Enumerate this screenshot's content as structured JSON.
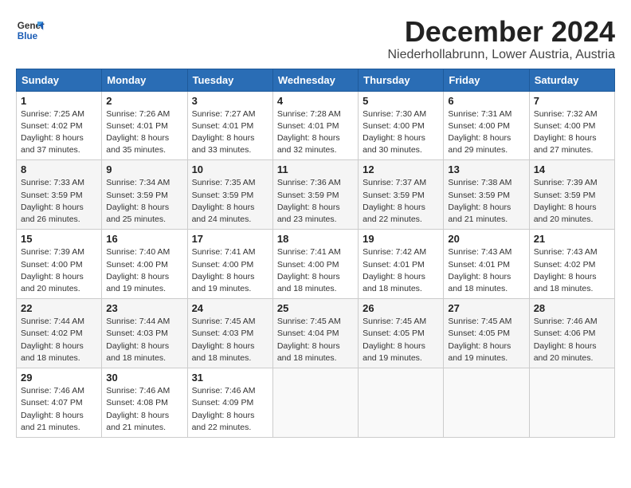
{
  "logo": {
    "line1": "General",
    "line2": "Blue"
  },
  "title": "December 2024",
  "subtitle": "Niederhollabrunn, Lower Austria, Austria",
  "headers": [
    "Sunday",
    "Monday",
    "Tuesday",
    "Wednesday",
    "Thursday",
    "Friday",
    "Saturday"
  ],
  "weeks": [
    [
      {
        "day": "1",
        "sunrise": "7:25 AM",
        "sunset": "4:02 PM",
        "daylight": "8 hours and 37 minutes."
      },
      {
        "day": "2",
        "sunrise": "7:26 AM",
        "sunset": "4:01 PM",
        "daylight": "8 hours and 35 minutes."
      },
      {
        "day": "3",
        "sunrise": "7:27 AM",
        "sunset": "4:01 PM",
        "daylight": "8 hours and 33 minutes."
      },
      {
        "day": "4",
        "sunrise": "7:28 AM",
        "sunset": "4:01 PM",
        "daylight": "8 hours and 32 minutes."
      },
      {
        "day": "5",
        "sunrise": "7:30 AM",
        "sunset": "4:00 PM",
        "daylight": "8 hours and 30 minutes."
      },
      {
        "day": "6",
        "sunrise": "7:31 AM",
        "sunset": "4:00 PM",
        "daylight": "8 hours and 29 minutes."
      },
      {
        "day": "7",
        "sunrise": "7:32 AM",
        "sunset": "4:00 PM",
        "daylight": "8 hours and 27 minutes."
      }
    ],
    [
      {
        "day": "8",
        "sunrise": "7:33 AM",
        "sunset": "3:59 PM",
        "daylight": "8 hours and 26 minutes."
      },
      {
        "day": "9",
        "sunrise": "7:34 AM",
        "sunset": "3:59 PM",
        "daylight": "8 hours and 25 minutes."
      },
      {
        "day": "10",
        "sunrise": "7:35 AM",
        "sunset": "3:59 PM",
        "daylight": "8 hours and 24 minutes."
      },
      {
        "day": "11",
        "sunrise": "7:36 AM",
        "sunset": "3:59 PM",
        "daylight": "8 hours and 23 minutes."
      },
      {
        "day": "12",
        "sunrise": "7:37 AM",
        "sunset": "3:59 PM",
        "daylight": "8 hours and 22 minutes."
      },
      {
        "day": "13",
        "sunrise": "7:38 AM",
        "sunset": "3:59 PM",
        "daylight": "8 hours and 21 minutes."
      },
      {
        "day": "14",
        "sunrise": "7:39 AM",
        "sunset": "3:59 PM",
        "daylight": "8 hours and 20 minutes."
      }
    ],
    [
      {
        "day": "15",
        "sunrise": "7:39 AM",
        "sunset": "4:00 PM",
        "daylight": "8 hours and 20 minutes."
      },
      {
        "day": "16",
        "sunrise": "7:40 AM",
        "sunset": "4:00 PM",
        "daylight": "8 hours and 19 minutes."
      },
      {
        "day": "17",
        "sunrise": "7:41 AM",
        "sunset": "4:00 PM",
        "daylight": "8 hours and 19 minutes."
      },
      {
        "day": "18",
        "sunrise": "7:41 AM",
        "sunset": "4:00 PM",
        "daylight": "8 hours and 18 minutes."
      },
      {
        "day": "19",
        "sunrise": "7:42 AM",
        "sunset": "4:01 PM",
        "daylight": "8 hours and 18 minutes."
      },
      {
        "day": "20",
        "sunrise": "7:43 AM",
        "sunset": "4:01 PM",
        "daylight": "8 hours and 18 minutes."
      },
      {
        "day": "21",
        "sunrise": "7:43 AM",
        "sunset": "4:02 PM",
        "daylight": "8 hours and 18 minutes."
      }
    ],
    [
      {
        "day": "22",
        "sunrise": "7:44 AM",
        "sunset": "4:02 PM",
        "daylight": "8 hours and 18 minutes."
      },
      {
        "day": "23",
        "sunrise": "7:44 AM",
        "sunset": "4:03 PM",
        "daylight": "8 hours and 18 minutes."
      },
      {
        "day": "24",
        "sunrise": "7:45 AM",
        "sunset": "4:03 PM",
        "daylight": "8 hours and 18 minutes."
      },
      {
        "day": "25",
        "sunrise": "7:45 AM",
        "sunset": "4:04 PM",
        "daylight": "8 hours and 18 minutes."
      },
      {
        "day": "26",
        "sunrise": "7:45 AM",
        "sunset": "4:05 PM",
        "daylight": "8 hours and 19 minutes."
      },
      {
        "day": "27",
        "sunrise": "7:45 AM",
        "sunset": "4:05 PM",
        "daylight": "8 hours and 19 minutes."
      },
      {
        "day": "28",
        "sunrise": "7:46 AM",
        "sunset": "4:06 PM",
        "daylight": "8 hours and 20 minutes."
      }
    ],
    [
      {
        "day": "29",
        "sunrise": "7:46 AM",
        "sunset": "4:07 PM",
        "daylight": "8 hours and 21 minutes."
      },
      {
        "day": "30",
        "sunrise": "7:46 AM",
        "sunset": "4:08 PM",
        "daylight": "8 hours and 21 minutes."
      },
      {
        "day": "31",
        "sunrise": "7:46 AM",
        "sunset": "4:09 PM",
        "daylight": "8 hours and 22 minutes."
      },
      null,
      null,
      null,
      null
    ]
  ]
}
